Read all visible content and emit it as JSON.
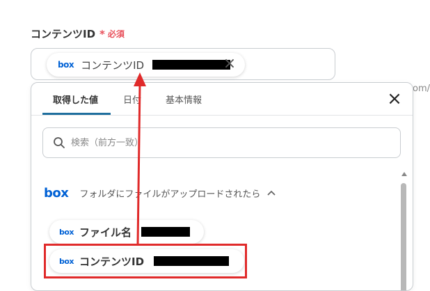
{
  "field": {
    "label": "コンテンツID",
    "required_mark": "*",
    "required_text": "必須"
  },
  "content_input": {
    "token": {
      "service_icon": "box-logo",
      "service_logo_text": "box",
      "label": "コンテンツID",
      "remove_icon": "close-icon"
    }
  },
  "background_fragment": "om/",
  "popup": {
    "tabs": [
      {
        "label": "取得した値",
        "active": true
      },
      {
        "label": "日付",
        "active": false
      },
      {
        "label": "基本情報",
        "active": false
      }
    ],
    "close_icon": "close-icon",
    "search": {
      "icon": "search-icon",
      "placeholder": "検索（前方一致）",
      "value": ""
    },
    "section": {
      "service_icon": "box-logo",
      "service_logo_text": "box",
      "title": "フォルダにファイルがアップロードされたら",
      "toggle_icon": "chevron-up-icon"
    },
    "items": [
      {
        "service_logo_text": "box",
        "label": "ファイル名"
      },
      {
        "service_logo_text": "box",
        "label": "コンテンツID"
      }
    ]
  },
  "colors": {
    "required": "#e8505b",
    "box_brand": "#0061d5",
    "active_tab_underline": "#1f6f9e",
    "annotation_red": "#e02a2a"
  }
}
